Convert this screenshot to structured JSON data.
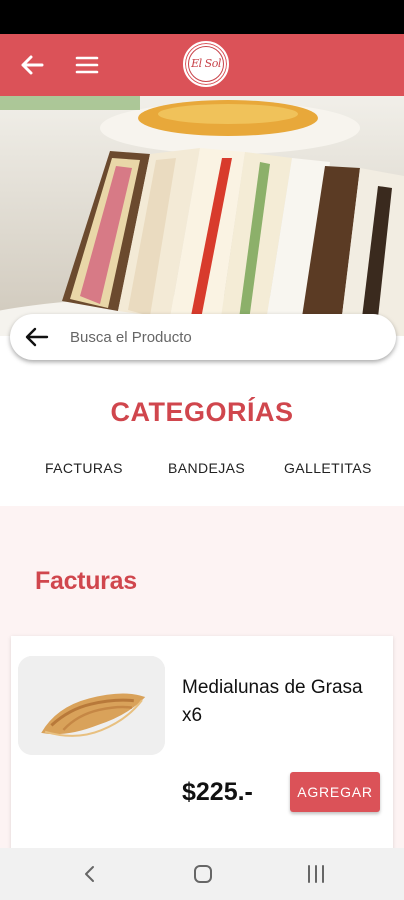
{
  "app": {
    "logo_text": "El Sol",
    "accent_color": "#db5258"
  },
  "header": {
    "back_icon": "arrow-left-icon",
    "menu_icon": "hamburger-menu-icon"
  },
  "search": {
    "placeholder": "Busca el Producto",
    "icon": "arrow-left-icon"
  },
  "categories": {
    "title": "CATEGORÍAS",
    "items": [
      {
        "label": "FACTURAS"
      },
      {
        "label": "BANDEJAS"
      },
      {
        "label": "GALLETITAS"
      }
    ]
  },
  "section": {
    "title": "Facturas"
  },
  "products": [
    {
      "name": "Medialunas de Grasa x6",
      "price": "$225.-",
      "button_label": "AGREGAR"
    }
  ],
  "system_nav": {
    "back_icon": "chevron-left-icon",
    "home_icon": "home-square-icon",
    "recents_icon": "recents-lines-icon"
  }
}
